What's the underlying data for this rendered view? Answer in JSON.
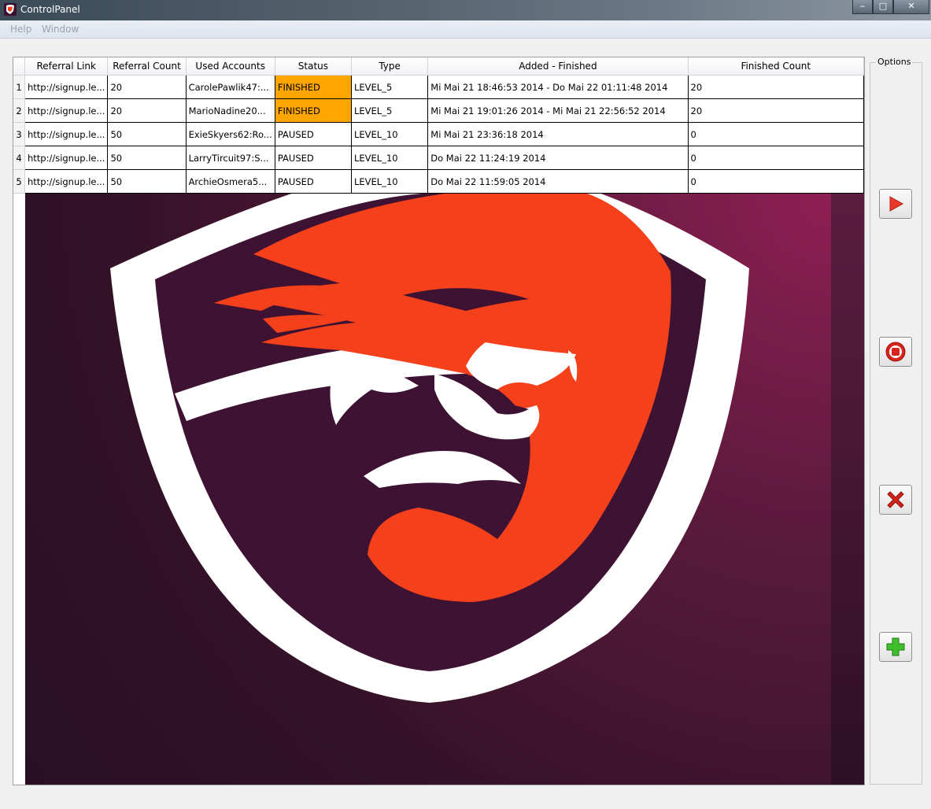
{
  "window": {
    "title": "ControlPanel",
    "minimize_glyph": "‒",
    "maximize_glyph": "□",
    "close_glyph": "✕"
  },
  "menu": {
    "items": [
      "Help",
      "Window"
    ]
  },
  "options": {
    "label": "Options",
    "buttons": [
      {
        "icon": "play-icon"
      },
      {
        "icon": "stop-icon"
      },
      {
        "icon": "delete-x-icon"
      },
      {
        "icon": "add-plus-icon"
      }
    ]
  },
  "table": {
    "columns": [
      "Referral Link",
      "Referral Count",
      "Used Accounts",
      "Status",
      "Type",
      "Added - Finished",
      "Finished Count"
    ],
    "rows": [
      {
        "num": "1",
        "link": "http://signup.le...",
        "count": "20",
        "accounts": "CarolePawlik47:...",
        "status": "FINISHED",
        "type": "LEVEL_5",
        "added": "Mi Mai 21 18:46:53 2014 - Do Mai 22 01:11:48 2014",
        "finished": "20"
      },
      {
        "num": "2",
        "link": "http://signup.le...",
        "count": "20",
        "accounts": "MarioNadine20...",
        "status": "FINISHED",
        "type": "LEVEL_5",
        "added": "Mi Mai 21 19:01:26 2014 - Mi Mai 21 22:56:52 2014",
        "finished": "20"
      },
      {
        "num": "3",
        "link": "http://signup.le...",
        "count": "50",
        "accounts": "ExieSkyers62:Ro...",
        "status": "PAUSED",
        "type": "LEVEL_10",
        "added": "Mi Mai 21 23:36:18 2014",
        "finished": "0"
      },
      {
        "num": "4",
        "link": "http://signup.le...",
        "count": "50",
        "accounts": "LarryTircuit97:S...",
        "status": "PAUSED",
        "type": "LEVEL_10",
        "added": "Do Mai 22 11:24:19 2014",
        "finished": "0"
      },
      {
        "num": "5",
        "link": "http://signup.le...",
        "count": "50",
        "accounts": "ArchieOsmera5...",
        "status": "PAUSED",
        "type": "LEVEL_10",
        "added": "Do Mai 22 11:59:05 2014",
        "finished": "0"
      }
    ]
  },
  "colors": {
    "finished_status": "#ffa500",
    "logo_orange": "#f5401c",
    "logo_white": "#ffffff",
    "logo_bg": "#3a1230"
  },
  "logo": {
    "icon": "tiger-shield-logo"
  }
}
